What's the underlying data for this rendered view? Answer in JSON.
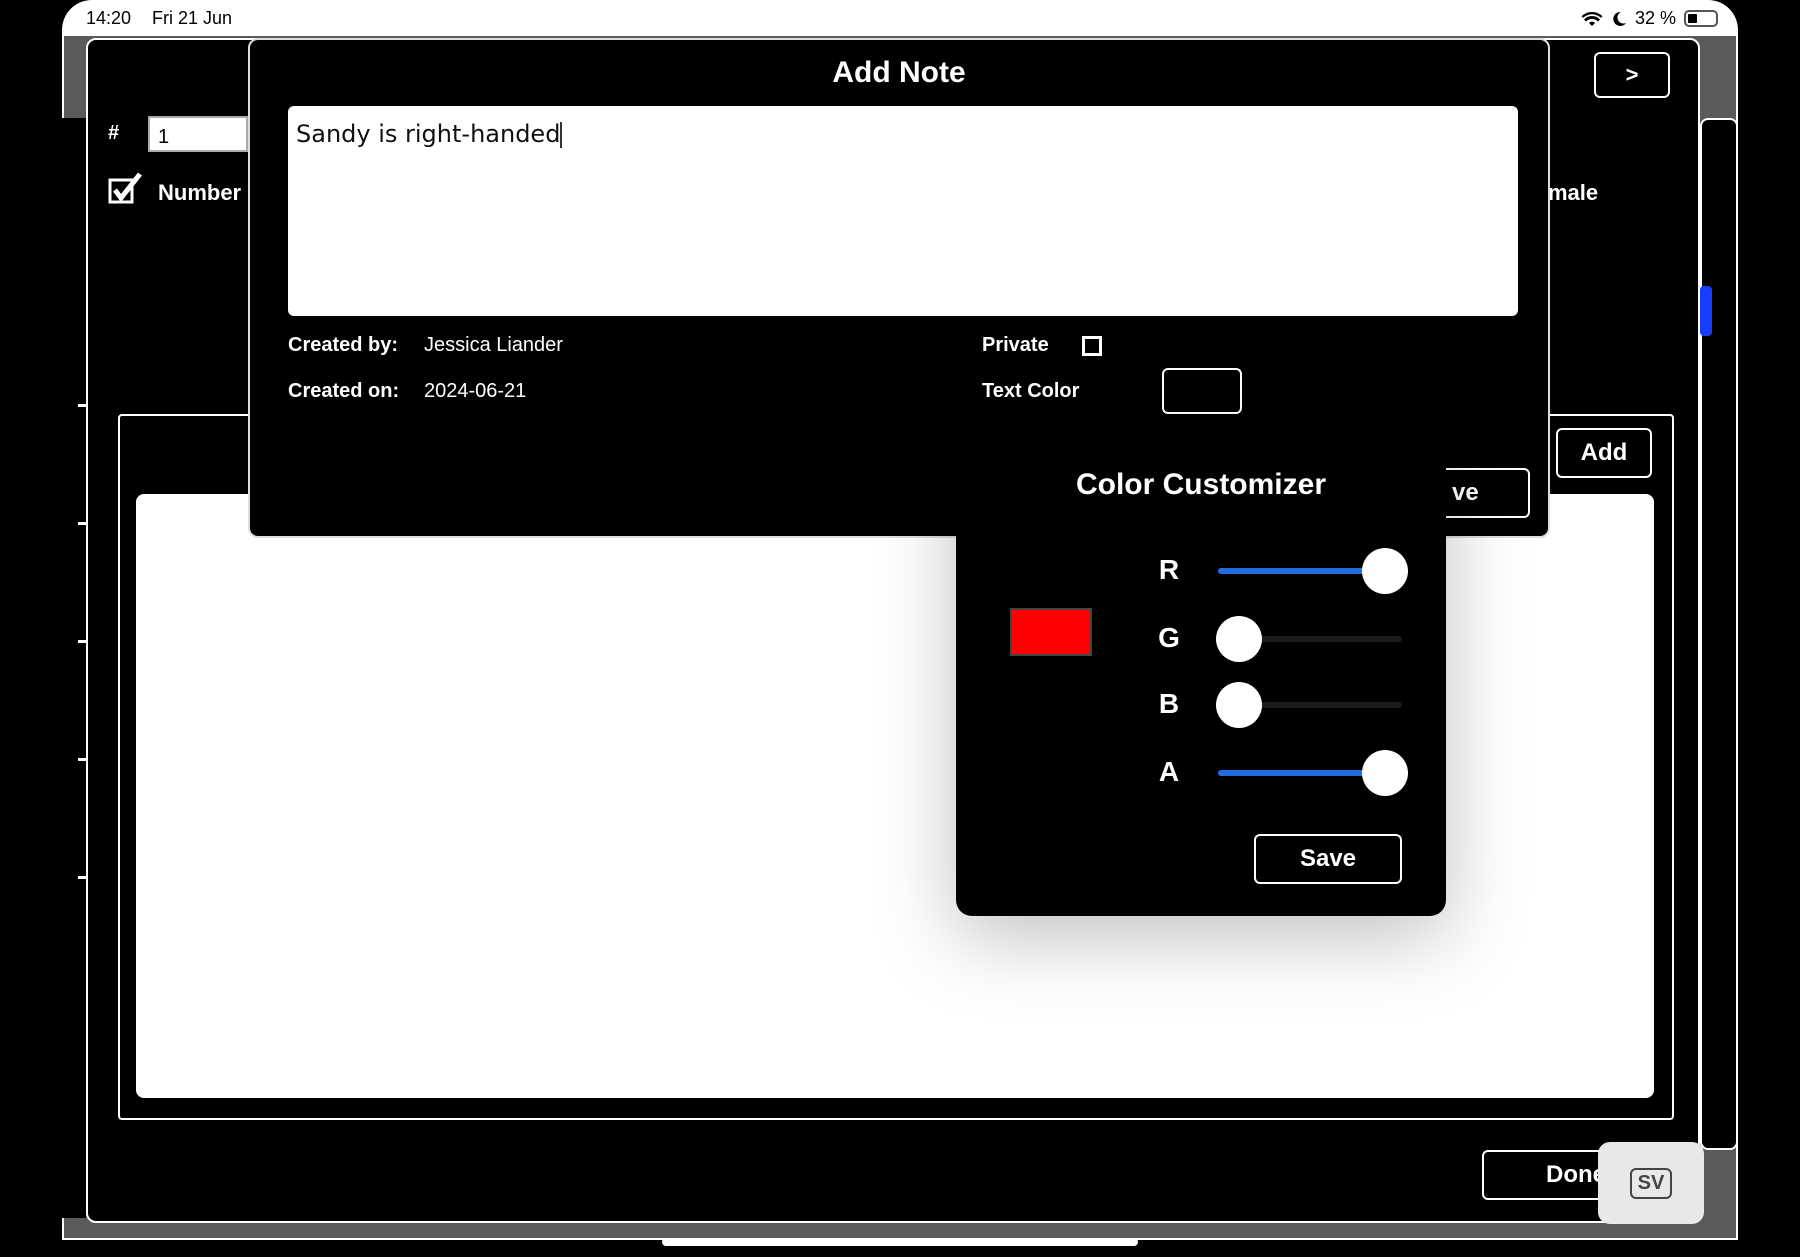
{
  "status_bar": {
    "time": "14:20",
    "date": "Fri 21 Jun",
    "battery": "32 %"
  },
  "background": {
    "number_field_symbol": "#",
    "number_value": "1",
    "number_checkbox_label": "Number",
    "gender_label_partial": "male",
    "next_button": ">",
    "add_button": "Add",
    "done_button": "Done",
    "badge": "SV"
  },
  "note_modal": {
    "title": "Add Note",
    "note_text": "Sandy is right-handed",
    "created_by_label": "Created by:",
    "created_by_value": "Jessica Liander",
    "created_on_label": "Created on:",
    "created_on_value": "2024-06-21",
    "private_label": "Private",
    "private_checked": false,
    "text_color_label": "Text Color",
    "save_button_partial": "ve"
  },
  "color_customizer": {
    "title": "Color Customizer",
    "preview_color": "#ff0000",
    "channels": [
      {
        "label": "R",
        "value": 1.0
      },
      {
        "label": "G",
        "value": 0.0
      },
      {
        "label": "B",
        "value": 0.0
      },
      {
        "label": "A",
        "value": 1.0
      }
    ],
    "save_button": "Save"
  }
}
